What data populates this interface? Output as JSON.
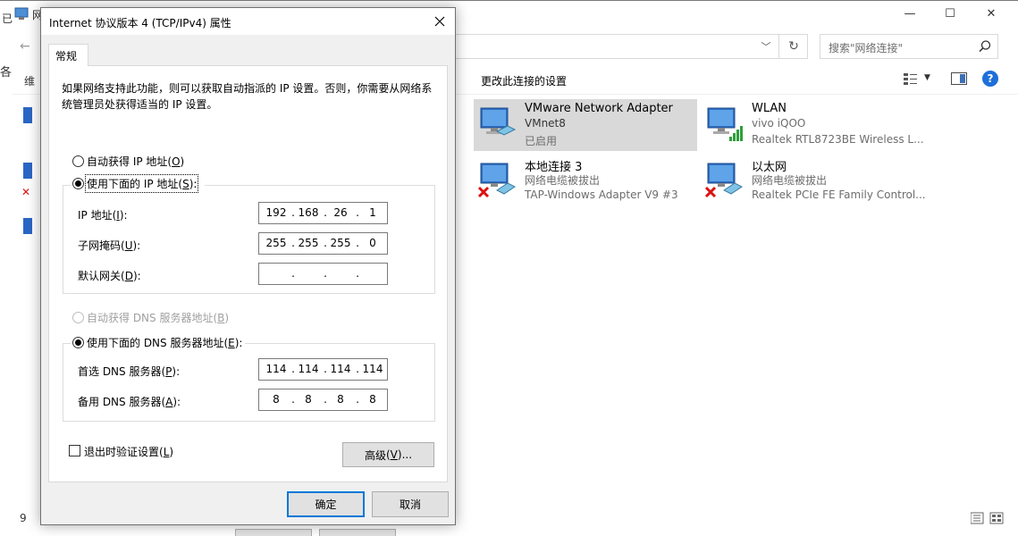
{
  "explorer": {
    "title_fragment": "网",
    "left_fragment": "已",
    "window_controls": {
      "minimize": "—",
      "maximize": "☐",
      "close": "✕"
    },
    "search_placeholder": "搜索\"网络连接\"",
    "command_change_settings": "更改此连接的设置",
    "status_count": "9",
    "connections": [
      {
        "name": "VMware Network Adapter",
        "line2": "VMnet8",
        "line3": "已启用",
        "status": "enabled",
        "selected": true
      },
      {
        "name": "WLAN",
        "line2": "vivo iQOO",
        "line3": "Realtek RTL8723BE Wireless L...",
        "status": "wireless"
      },
      {
        "name": "本地连接 3",
        "line2": "网络电缆被拔出",
        "line3": "TAP-Windows Adapter V9 #3",
        "status": "disconnected"
      },
      {
        "name": "以太网",
        "line2": "网络电缆被拔出",
        "line3": "Realtek PCIe FE Family Control...",
        "status": "disconnected"
      }
    ]
  },
  "dialog": {
    "title": "Internet 协议版本 4 (TCP/IPv4) 属性",
    "tab": "常规",
    "description": "如果网络支持此功能，则可以获取自动指派的 IP 设置。否则，你需要从网络系统管理员处获得适当的 IP 设置。",
    "ip": {
      "auto_label": "自动获得 IP 地址",
      "auto_key": "O",
      "manual_label": "使用下面的 IP 地址",
      "manual_key": "S",
      "selected": "manual",
      "fields": [
        {
          "label": "IP 地址",
          "key": "I",
          "octets": [
            "192",
            "168",
            "26",
            "1"
          ]
        },
        {
          "label": "子网掩码",
          "key": "U",
          "octets": [
            "255",
            "255",
            "255",
            "0"
          ]
        },
        {
          "label": "默认网关",
          "key": "D",
          "octets": [
            "",
            "",
            "",
            ""
          ]
        }
      ]
    },
    "dns": {
      "auto_label": "自动获得 DNS 服务器地址",
      "auto_key": "B",
      "manual_label": "使用下面的 DNS 服务器地址",
      "manual_key": "E",
      "selected": "manual",
      "fields": [
        {
          "label": "首选 DNS 服务器",
          "key": "P",
          "octets": [
            "114",
            "114",
            "114",
            "114"
          ]
        },
        {
          "label": "备用 DNS 服务器",
          "key": "A",
          "octets": [
            "8",
            "8",
            "8",
            "8"
          ]
        }
      ]
    },
    "validate_label": "退出时验证设置",
    "validate_key": "L",
    "validate_checked": false,
    "advanced_label": "高级",
    "advanced_key": "V",
    "advanced_suffix": "...",
    "ok_label": "确定",
    "cancel_label": "取消"
  }
}
